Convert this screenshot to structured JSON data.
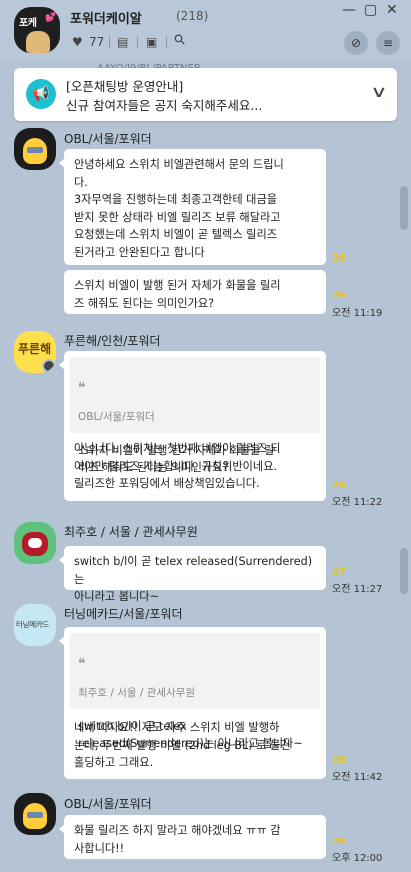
{
  "header": {
    "room_avatar_text": "포케",
    "room_avatar_heart": "💕",
    "title": "포워더케이알",
    "member_count": "(218)",
    "likes_count": "77",
    "icons": [
      "heart-icon",
      "document-icon",
      "inbox-icon",
      "search-icon",
      "mute-icon",
      "menu-icon",
      "window-minimize-icon",
      "window-maximize-icon",
      "window-close-icon"
    ],
    "glyphs": {
      "heart": "♥",
      "doc": "▤",
      "inbox": "▣",
      "search": "⚲",
      "mute": "⊘",
      "menu": "≡",
      "minimize": "—",
      "maximize": "▢",
      "close": "✕"
    }
  },
  "peek_text": "AAYO/I9/BL/PARTNER",
  "notice": {
    "line1": "[오픈채팅방 운영안내]",
    "line2": "신규 참여자들은 공지 숙지해주세요...",
    "icon": "megaphone-icon",
    "icon_glyph": "📢",
    "chevron": "∨"
  },
  "messages": [
    {
      "sender": "OBL/서울/포워더",
      "avatar": "obl",
      "bubbles": [
        {
          "text": "안녕하세요 스위치 비엘관련해서 문의 드립니\n다.\n3자무역을 진행하는데 최종고객한테 대금을\n받지 못한 상태라 비엘 릴리즈 보류 해달라고\n요청했는데 스위치 비엘이 곧 텔렉스 릴리즈\n된거라고 안완된다고 합니다",
          "unread": "26",
          "time": ""
        },
        {
          "text": "스위치 비엘이 발행 된거 자체가 화물을 릴리\n즈 해줘도 된다는 의미인가요?",
          "unread": "26",
          "time": "오전 11:19"
        }
      ]
    },
    {
      "sender": "푸른해/인천/포워더",
      "avatar": "blue",
      "avatar_text": "푸른해",
      "reply": {
        "name": "OBL/서울/포워더",
        "text": "스위치 비엘이 발행 된거 자체가 화물을 릴\n리즈 해줘도 된다는 의미인가요?"
      },
      "text": "아닙니다. 스위치는 첫번째 비엘이 릴리즈 되\n어야만 릴리즈 가능합니다. 규칙위반이네요.\n릴리즈한 포워딩에서 배상책임있습니다.",
      "unread": "26",
      "time": "오전 11:22"
    },
    {
      "sender": "최주호 / 서울 / 관세사무원",
      "avatar": "choi",
      "text": "switch b/l이 곧 telex released(Surrendered)는\n아니라고 봅니다~",
      "unread": "27",
      "time": "오전 11:27"
    },
    {
      "sender": "터닝메카드/서울/포워더",
      "avatar": "tuning",
      "avatar_text": "터닝메카드",
      "reply": {
        "name": "최주호 / 서울 / 관세사무원",
        "text": "switch b/l이 곧 telex\nreleased(Surrendered)는 아니라고 봅니다~"
      },
      "text": "네네 마자요!! 저도 자주 스위치 비엘 발행하\n는데, 두번째 발행 비엘 (2nd leg BL) 로 물건\n홀딩하고 그래요.",
      "unread": "28",
      "time": "오전 11:42"
    },
    {
      "sender": "OBL/서울/포워더",
      "avatar": "obl",
      "text": "화물 릴리즈 하지 말라고 해야겠네요 ㅠㅠ 감\n사합니다!!",
      "unread": "28",
      "time": "오후 12:00"
    }
  ],
  "quote_glyph": "❝"
}
